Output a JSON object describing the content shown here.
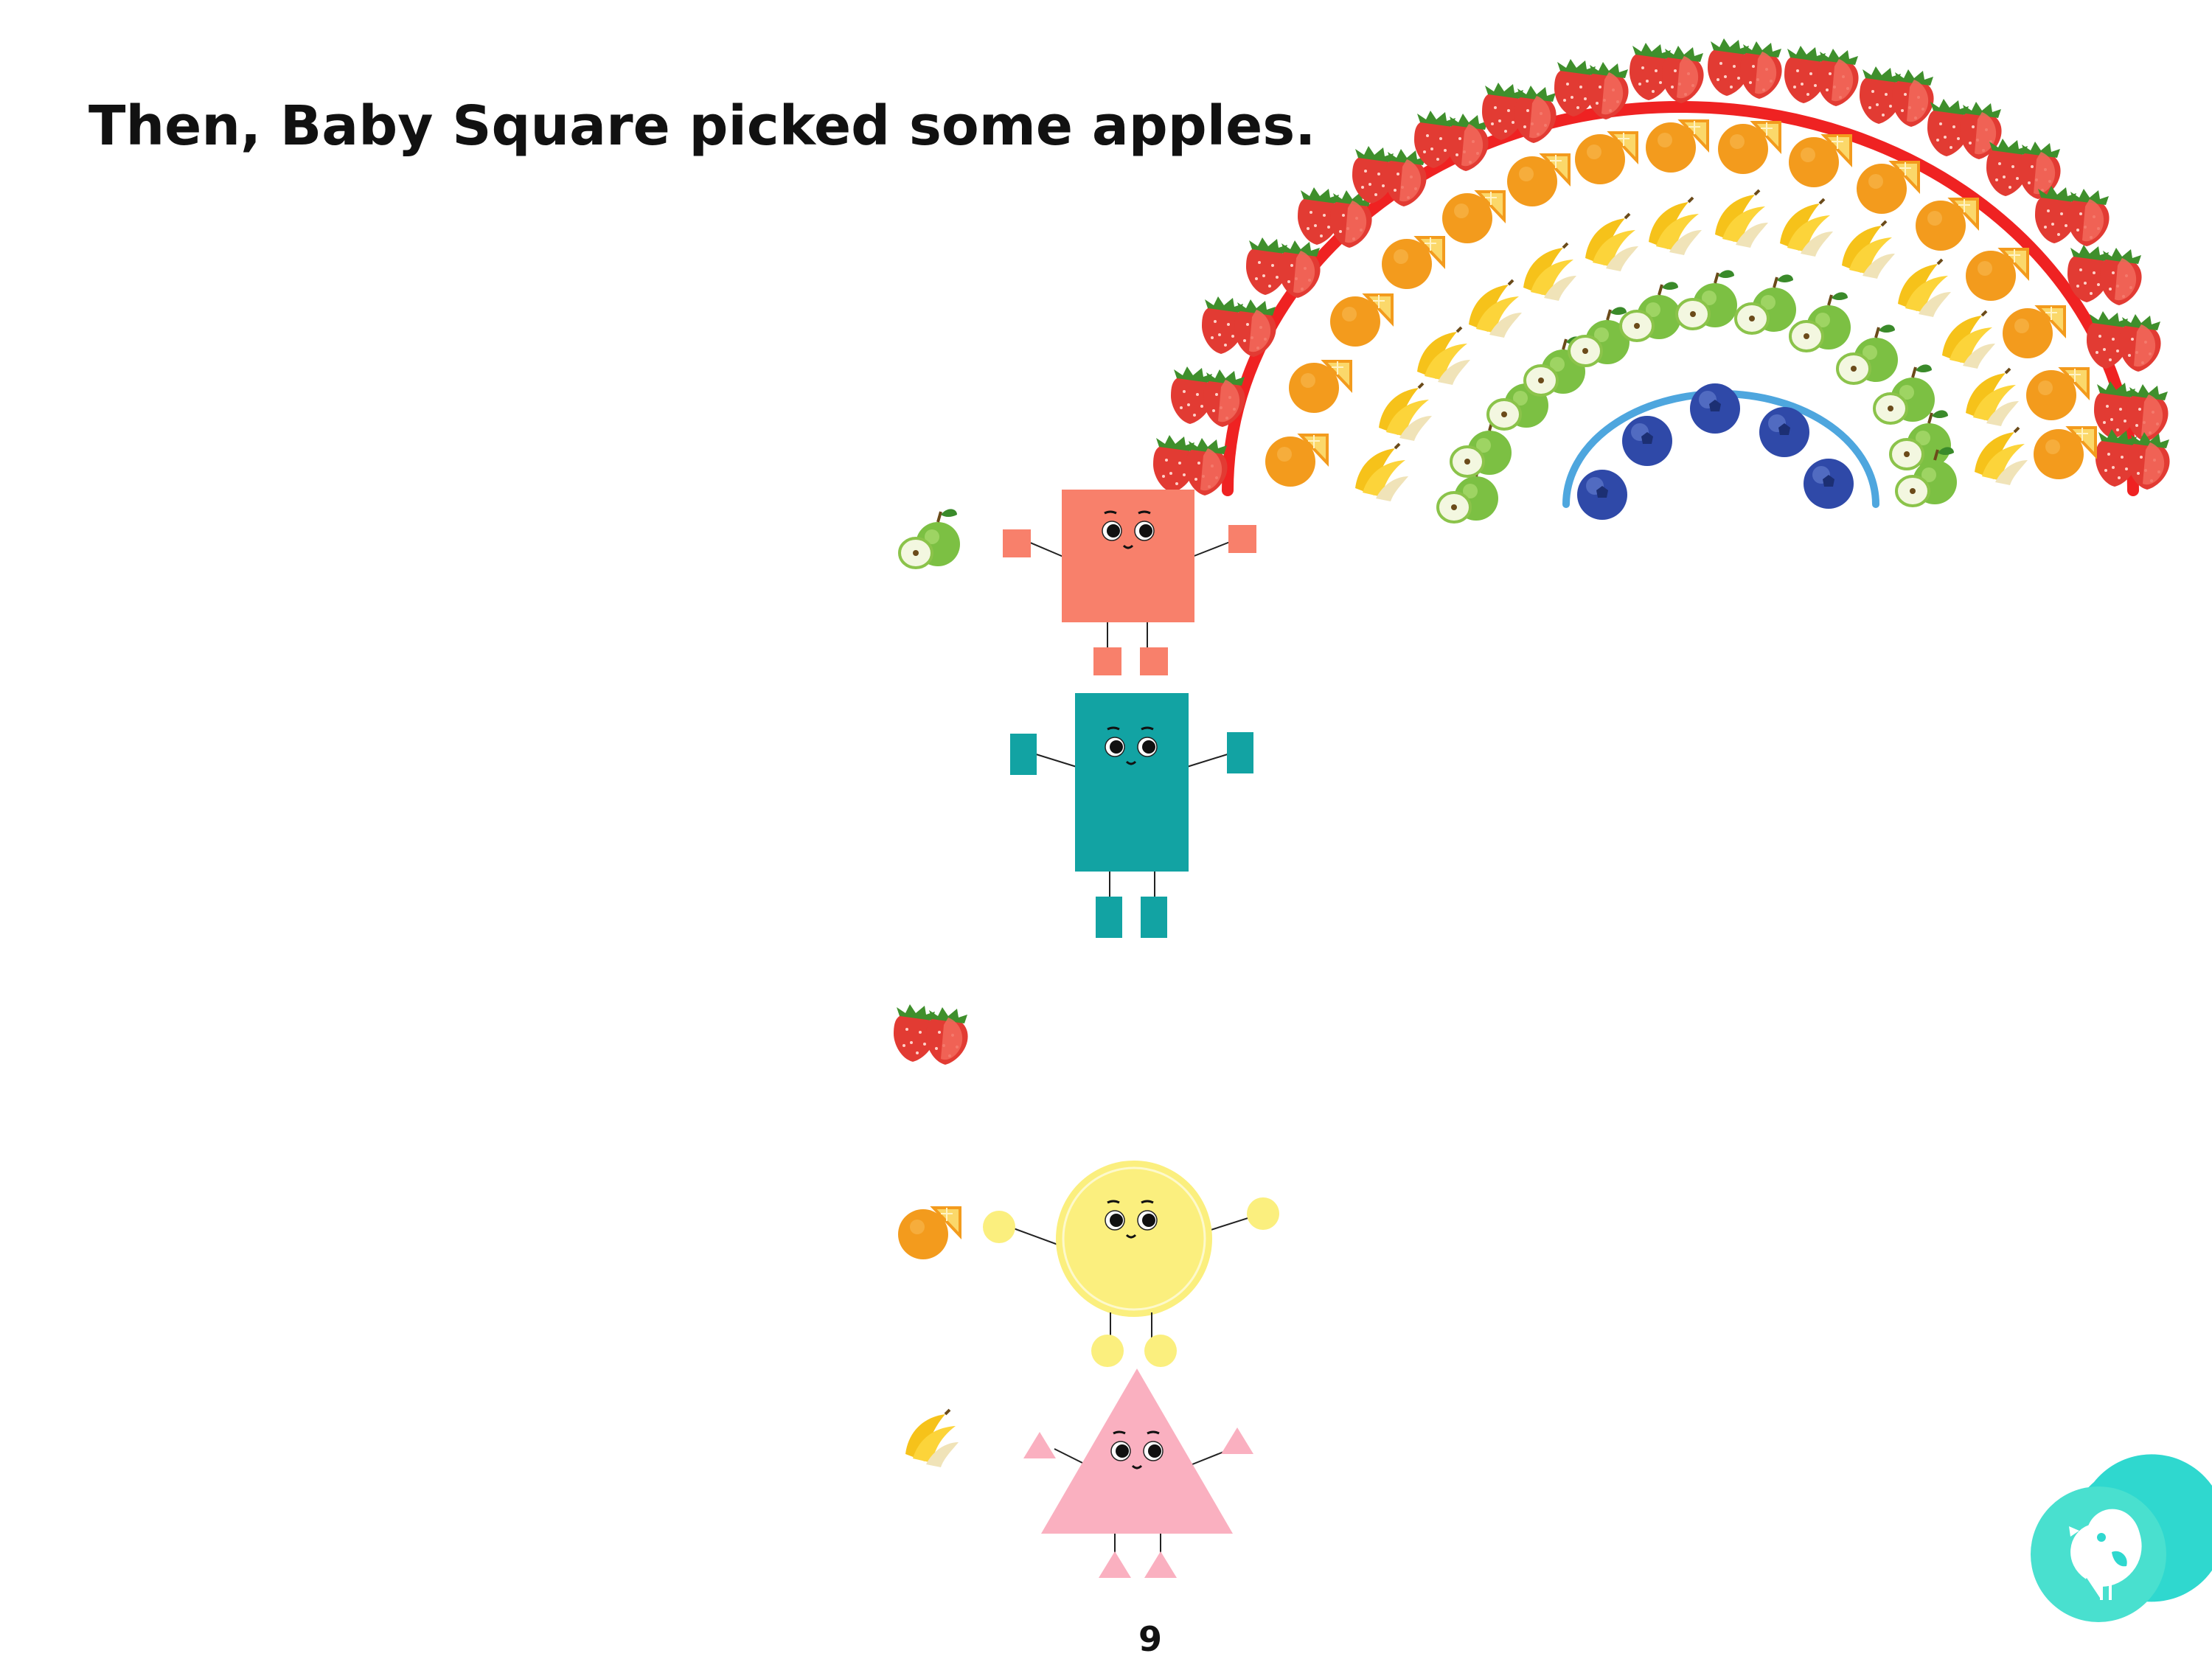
{
  "story": {
    "text": "Then, Baby Square picked some apples.",
    "page_number": "9"
  },
  "colors": {
    "background": "#ffffff",
    "square": "#f8806b",
    "rectangle": "#12a3a3",
    "circle": "#fbef7e",
    "triangle": "#fab0c0",
    "rainbow_red": "#ef2222",
    "rainbow_blue": "#4ea6de",
    "logo": "#2fd8cf"
  },
  "rainbow": {
    "bands": [
      "strawberry",
      "orange",
      "banana",
      "green-apple",
      "blueberry"
    ]
  },
  "characters": [
    {
      "name": "square",
      "fruit": "green-apple"
    },
    {
      "name": "rectangle",
      "fruit": "strawberry"
    },
    {
      "name": "circle",
      "fruit": "orange"
    },
    {
      "name": "triangle",
      "fruit": "banana"
    }
  ],
  "icons": [
    "bird-logo-icon"
  ]
}
